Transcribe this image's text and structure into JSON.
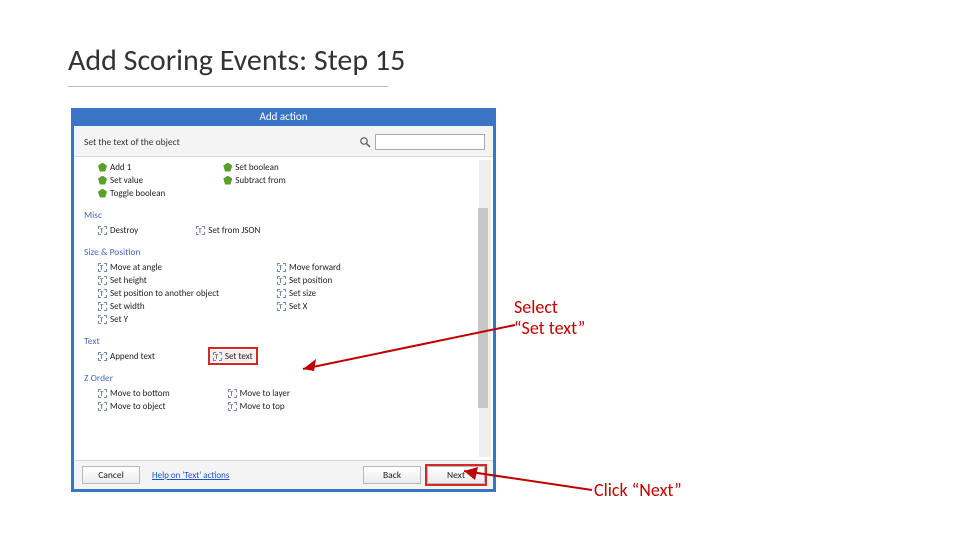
{
  "slide": {
    "title": "Add Scoring Events: Step 15"
  },
  "dialog": {
    "title": "Add action",
    "search_label": "Set the text of the object",
    "search_value": "",
    "categories": {
      "top": {
        "left": [
          "Add 1",
          "Set value",
          "Toggle boolean"
        ],
        "right": [
          "Set boolean",
          "Subtract from"
        ]
      },
      "misc": {
        "label": "Misc",
        "left": [
          "Destroy"
        ],
        "right": [
          "Set from JSON"
        ]
      },
      "size": {
        "label": "Size & Position",
        "left": [
          "Move at angle",
          "Set height",
          "Set position to another object",
          "Set width",
          "Set Y"
        ],
        "right": [
          "Move forward",
          "Set position",
          "Set size",
          "Set X"
        ]
      },
      "text": {
        "label": "Text",
        "left": [
          "Append text"
        ],
        "right": [
          "Set text"
        ]
      },
      "zorder": {
        "label": "Z Order",
        "left": [
          "Move to bottom",
          "Move to object"
        ],
        "right": [
          "Move to layer",
          "Move to top"
        ]
      }
    },
    "help_link": "Help on 'Text' actions",
    "buttons": {
      "cancel": "Cancel",
      "back": "Back",
      "next": "Next"
    }
  },
  "annotations": {
    "select_line1": "Select",
    "select_line2": "Set text",
    "click_line1": "Click ",
    "click_next": "Next"
  }
}
